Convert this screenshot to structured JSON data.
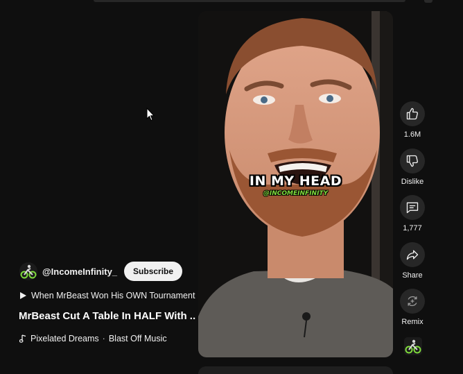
{
  "channel": {
    "handle": "@IncomeInfinity_",
    "subscribe_label": "Subscribe",
    "avatar_icon": "cyclist-logo-icon"
  },
  "playlist": {
    "label": "When MrBeast Won His OWN Tournament",
    "icon": "play-icon"
  },
  "video": {
    "title": "MrBeast Cut A Table In HALF With ...",
    "caption": "IN MY HEAD",
    "watermark": "@INCOMEINFINITY"
  },
  "music": {
    "icon": "music-note-icon",
    "track": "Pixelated Dreams",
    "separator": "·",
    "artist": "Blast Off Music"
  },
  "actions": {
    "like": {
      "icon": "thumbs-up-icon",
      "label": "1.6M"
    },
    "dislike": {
      "icon": "thumbs-down-icon",
      "label": "Dislike"
    },
    "comments": {
      "icon": "comment-icon",
      "label": "1,777"
    },
    "share": {
      "icon": "share-icon",
      "label": "Share"
    },
    "remix": {
      "icon": "remix-icon",
      "label": "Remix"
    }
  },
  "colors": {
    "background": "#0f0f0f",
    "button_bg": "#272727",
    "subscribe_bg": "#f1f1f1",
    "caption_accent": "#7fdc3c"
  }
}
